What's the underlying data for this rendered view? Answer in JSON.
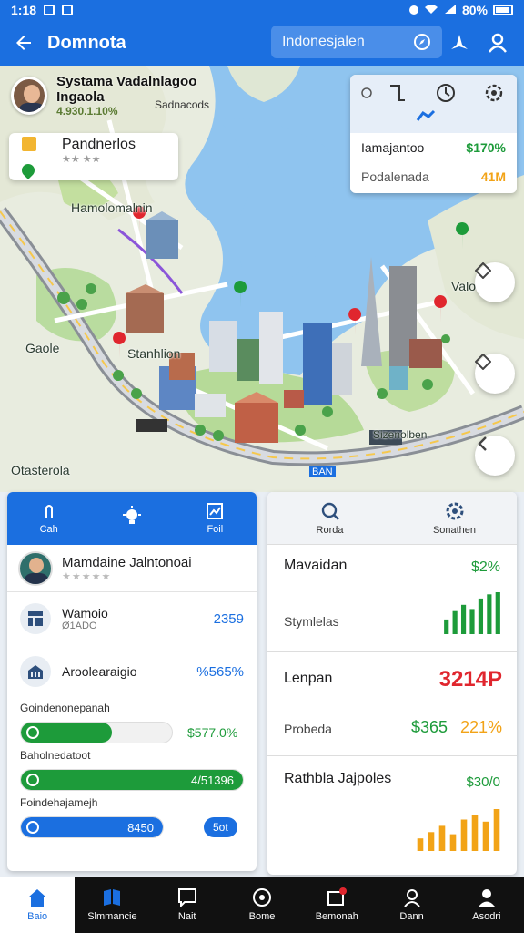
{
  "status_bar": {
    "time": "1:18",
    "battery": "80%"
  },
  "app_bar": {
    "title": "Domnota",
    "search_placeholder": "Indonesjalen"
  },
  "map": {
    "profile": {
      "name": "Systama Vadalnlagoo Ingaola",
      "rating": "4.930.1.10%",
      "sub": "Sadnacods"
    },
    "place_card": {
      "title": "Pandnerlos",
      "stars": "★★ ★★"
    },
    "labels": {
      "park": "Hamolomalnin",
      "district_left": "Gaole",
      "station": "Stanhlion",
      "harbor": "Sizenolben",
      "bottom_left": "Otasterola",
      "right": "Valo",
      "highway": "BAN"
    },
    "stats_card": {
      "rows": [
        {
          "label": "Iamajantoo",
          "value": "$170%",
          "color": "#1d9b3a"
        },
        {
          "label": "Podalenada",
          "value": "41M",
          "color": "#f2a317"
        }
      ]
    }
  },
  "left_panel": {
    "tabs": [
      {
        "label": "Cah",
        "icon": "hand-icon"
      },
      {
        "label": "",
        "icon": "lightbulb-icon"
      },
      {
        "label": "Foil",
        "icon": "chart-icon"
      }
    ],
    "user": {
      "name": "Mamdaine Jalntonoai",
      "stars": "★★★★★"
    },
    "items": [
      {
        "title": "Wamoio",
        "sub": "Ø1ADO",
        "value": "2359"
      },
      {
        "title": "Aroolearaigio",
        "sub": "",
        "value": "%565%"
      }
    ],
    "progress": [
      {
        "label": "Goindenonepanah",
        "value": "$577.0%",
        "value_color": "#1d9b3a",
        "fill": 0.6,
        "color": "#1d9b3a"
      },
      {
        "label": "Baholnedatoot",
        "value": "4/51396",
        "value_color": "#ffffff",
        "fill": 1.0,
        "color": "#1d9b3a"
      },
      {
        "label": "Foindehajamejh",
        "value": "8450",
        "value_color": "#ffffff",
        "fill": 1.0,
        "color": "#1b6fe0",
        "badge": "5ot"
      }
    ]
  },
  "right_panel": {
    "tabs": [
      {
        "label": "Rorda",
        "icon": "search-icon"
      },
      {
        "label": "Sonathen",
        "icon": "gear-icon"
      }
    ],
    "sections": [
      {
        "title": "Mavaidan",
        "value": "$2%",
        "value_color": "#1d9b3a",
        "sub": "Stymlelas",
        "bars": [
          0.35,
          0.55,
          0.7,
          0.6,
          0.85,
          0.95,
          1.0
        ],
        "bar_color": "#1d9b3a"
      },
      {
        "title": "Lenpan",
        "value": "3214P",
        "value_color": "#e0262e",
        "sub": "Probeda",
        "value2": "$365",
        "value2_color": "#1d9b3a",
        "value3": "221%",
        "value3_color": "#f2a317"
      },
      {
        "title": "Rathbla Jajpoles",
        "value": "$30/0",
        "value_color": "#1d9b3a",
        "bars": [
          0.3,
          0.45,
          0.6,
          0.4,
          0.75,
          0.85,
          0.7,
          1.0
        ],
        "bar_color": "#f2a317"
      }
    ]
  },
  "bottom_nav": [
    {
      "label": "Baio",
      "icon": "home-icon",
      "active": true
    },
    {
      "label": "Slmmancie",
      "icon": "layers-icon",
      "active": false
    },
    {
      "label": "Nait",
      "icon": "message-icon",
      "active": false
    },
    {
      "label": "Bome",
      "icon": "compass-icon",
      "active": false
    },
    {
      "label": "Bemonah",
      "icon": "notification-icon",
      "active": false
    },
    {
      "label": "Dann",
      "icon": "support-icon",
      "active": false
    },
    {
      "label": "Asodri",
      "icon": "profile-icon",
      "active": false
    }
  ]
}
